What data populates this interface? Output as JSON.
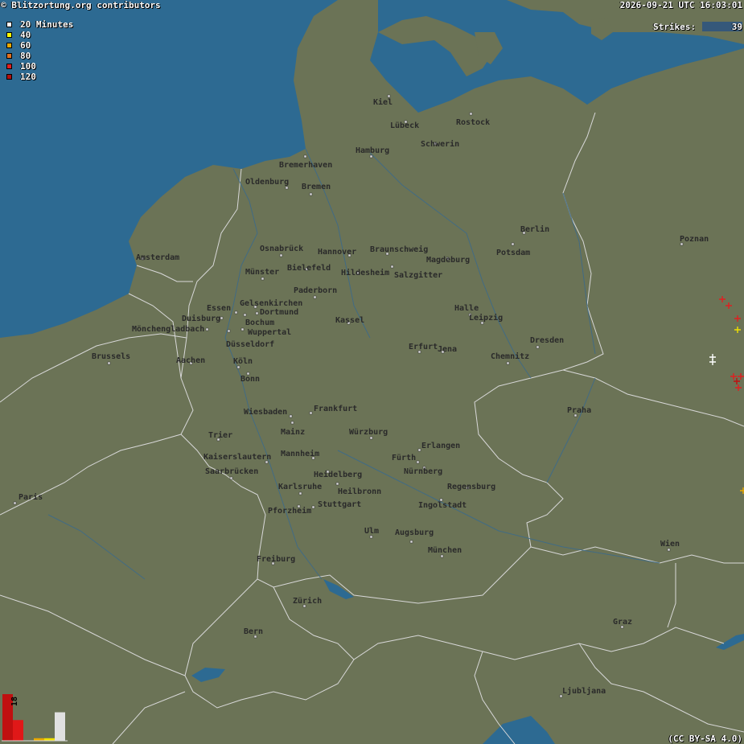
{
  "header": {
    "attribution": "© Blitzortung.org contributors",
    "timestamp": "2026-09-21 UTC 16:03:01",
    "strikes_label": "Strikes:",
    "strikes_count": "39",
    "license": "(CC BY-SA 4.0)"
  },
  "legend": {
    "items": [
      {
        "label": "20 Minutes",
        "color": "#ffffff"
      },
      {
        "label": "40",
        "color": "#ffff00"
      },
      {
        "label": "60",
        "color": "#e8a800"
      },
      {
        "label": "80",
        "color": "#e07020"
      },
      {
        "label": "100",
        "color": "#e02020"
      },
      {
        "label": "120",
        "color": "#b01010"
      }
    ]
  },
  "histogram": {
    "max_label": "18",
    "bars": [
      {
        "value": 18,
        "color": "#c01010"
      },
      {
        "value": 8,
        "color": "#e01818"
      },
      {
        "value": 0,
        "color": "#e06020"
      },
      {
        "value": 1,
        "color": "#e8a800"
      },
      {
        "value": 1,
        "color": "#f0e000"
      },
      {
        "value": 11,
        "color": "#e0e0e0"
      }
    ]
  },
  "colors": {
    "sea": "#2d6a92",
    "land": "#6b7356",
    "border": "#d8d8d8",
    "river": "#3d6a8a",
    "label": "#2a2a2a"
  },
  "cities": [
    "Kiel",
    "Lübeck",
    "Rostock",
    "Hamburg",
    "Schwerin",
    "Bremerhaven",
    "Oldenburg",
    "Bremen",
    "Berlin",
    "Potsdam",
    "Poznan",
    "Osnabrück",
    "Hannover",
    "Braunschweig",
    "Magdeburg",
    "Amsterdam",
    "Münster",
    "Bielefeld",
    "Hildesheim",
    "Salzgitter",
    "Paderborn",
    "Gelsenkirchen",
    "Dortmund",
    "Essen",
    "Duisburg",
    "Bochum",
    "Wuppertal",
    "Mönchengladbach",
    "Düsseldorf",
    "Halle",
    "Leipzig",
    "Kassel",
    "Dresden",
    "Erfurt",
    "Jena",
    "Chemnitz",
    "Brussels",
    "Aachen",
    "Köln",
    "Bonn",
    "Praha",
    "Wiesbaden",
    "Frankfurt",
    "Mainz",
    "Würzburg",
    "Erlangen",
    "Trier",
    "Kaiserslautern",
    "Mannheim",
    "Fürth",
    "Nürnberg",
    "Saarbrücken",
    "Heidelberg",
    "Regensburg",
    "Paris",
    "Karlsruhe",
    "Heilbronn",
    "Stuttgart",
    "Ingolstadt",
    "Pforzheim",
    "Ulm",
    "Augsburg",
    "Wien",
    "München",
    "Freiburg",
    "Zürich",
    "Bern",
    "Graz",
    "Ljubljana"
  ]
}
